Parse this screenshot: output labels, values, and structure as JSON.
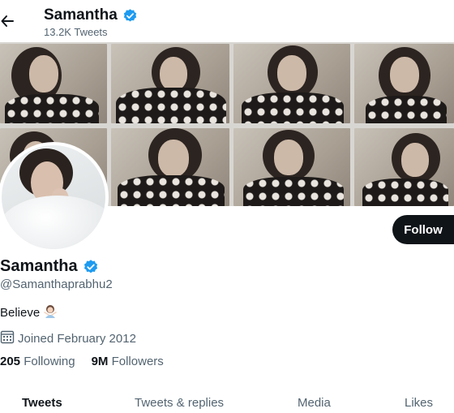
{
  "header": {
    "title": "Samantha",
    "tweet_count": "13.2K Tweets",
    "verified_color": "#1d9bf0"
  },
  "profile": {
    "name": "Samantha",
    "handle": "@Samanthaprabhu2",
    "bio": "Believe",
    "bio_emoji": "person-gesturing-emoji",
    "joined": "Joined February 2012",
    "following_count": "205",
    "following_label": "Following",
    "followers_count": "9M",
    "followers_label": "Followers"
  },
  "actions": {
    "follow_label": "Follow"
  },
  "tabs": [
    {
      "label": "Tweets",
      "active": true
    },
    {
      "label": "Tweets & replies",
      "active": false
    },
    {
      "label": "Media",
      "active": false
    },
    {
      "label": "Likes",
      "active": false
    }
  ]
}
